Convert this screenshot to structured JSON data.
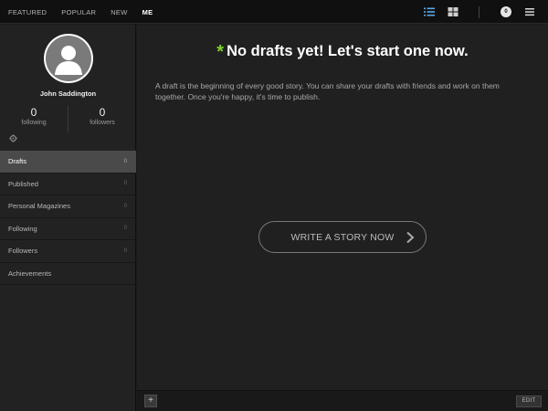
{
  "nav": {
    "tabs": [
      {
        "label": "FEATURED"
      },
      {
        "label": "POPULAR"
      },
      {
        "label": "NEW"
      },
      {
        "label": "ME"
      }
    ],
    "active_tab": "ME",
    "notification_count": "0",
    "icons": [
      "list-view-icon",
      "grid-view-icon",
      "notifications-badge",
      "menu-icon"
    ]
  },
  "profile": {
    "name": "John Saddington",
    "following_count": "0",
    "following_label": "following",
    "followers_count": "0",
    "followers_label": "followers"
  },
  "menu": {
    "items": [
      {
        "label": "Drafts",
        "count": "0"
      },
      {
        "label": "Published",
        "count": "0"
      },
      {
        "label": "Personal Magazines",
        "count": "0"
      },
      {
        "label": "Following",
        "count": "0"
      },
      {
        "label": "Followers",
        "count": "0"
      },
      {
        "label": "Achievements",
        "count": ""
      }
    ],
    "active": "Drafts"
  },
  "main": {
    "star": "*",
    "headline": "No drafts yet! Let's start one now.",
    "description": "A draft is the beginning of every good story. You can share your drafts with friends and work on them together. Once you're happy, it's time to publish.",
    "cta_label": "WRITE A STORY NOW"
  },
  "footer": {
    "add_label": "+",
    "edit_label": "EDIT"
  },
  "colors": {
    "accent_green": "#7fd22a",
    "active_icon_blue": "#5aa8e6"
  }
}
